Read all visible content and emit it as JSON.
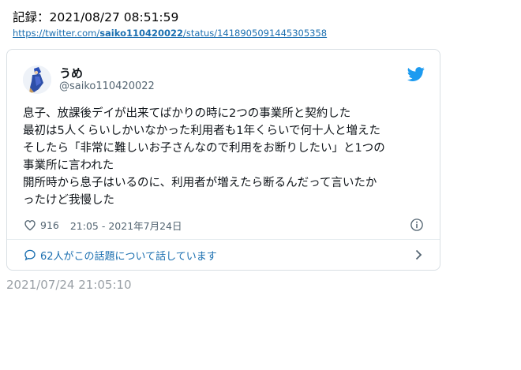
{
  "record": {
    "label": "記録：2021/08/27 08:51:59"
  },
  "source_link": {
    "prefix": "https://twitter.com/",
    "user": "saiko110420022",
    "suffix": "/status/1418905091445305358"
  },
  "tweet": {
    "display_name": "うめ",
    "handle": "@saiko110420022",
    "lines": [
      "息子、放課後デイが出来てばかりの時に2つの事業所と契約した",
      "最初は5人くらいしかいなかった利用者も1年くらいで何十人と増えた",
      "そしたら「非常に難しいお子さんなので利用をお断りしたい」と1つの",
      "事業所に言われた",
      "開所時から息子はいるのに、利用者が増えたら断るんだって言いたか",
      "ったけど我慢した"
    ],
    "likes": "916",
    "timestamp": "21:05 - 2021年7月24日",
    "replies_text": "62人がこの話題について話しています"
  },
  "capture_date": "2021/07/24 21:05:10",
  "icons": {
    "twitter": "twitter-bird-icon",
    "like": "heart-icon",
    "info": "info-icon",
    "reply": "speech-bubble-icon",
    "chevron": "chevron-right-icon"
  },
  "colors": {
    "link": "#1b6fb0",
    "twitter_blue": "#1d9bf0",
    "border": "#d9dfe4",
    "muted": "#536471",
    "bottom_date": "#9aa0a6"
  }
}
